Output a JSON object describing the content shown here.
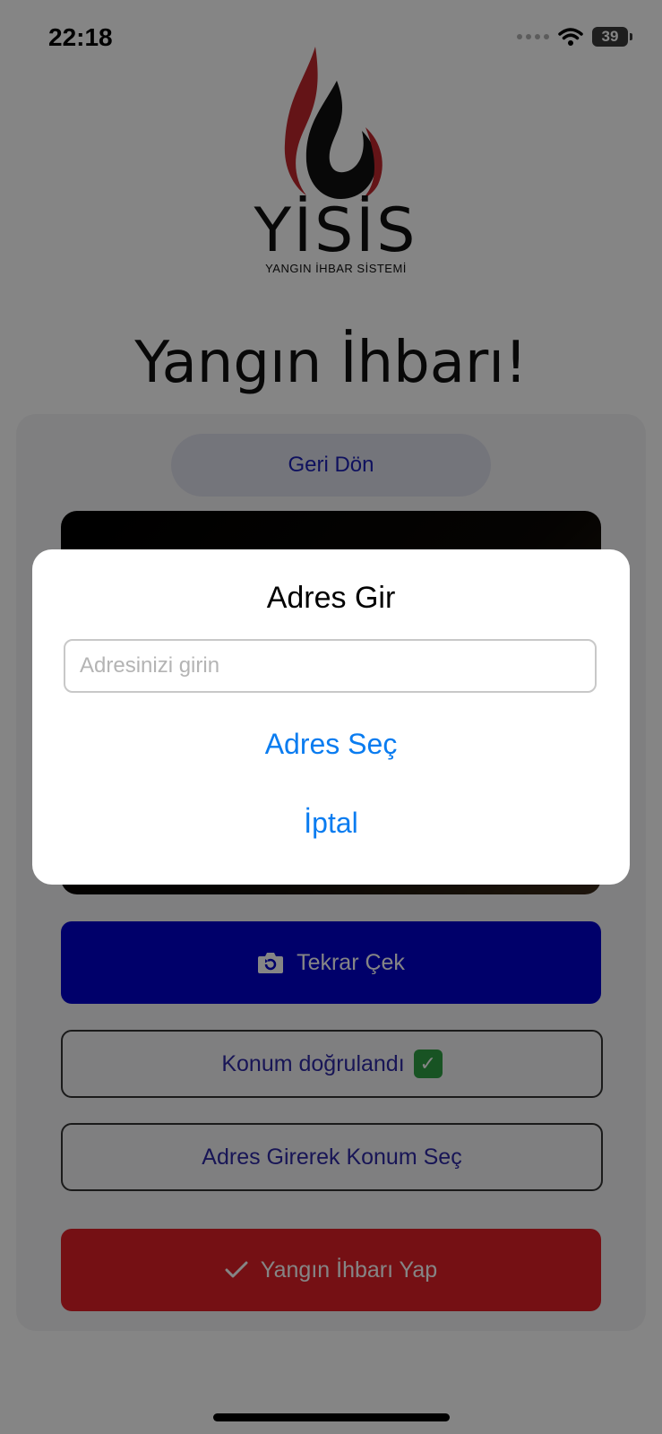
{
  "status_bar": {
    "time": "22:18",
    "battery": "39"
  },
  "logo": {
    "word": "YİSİS",
    "subtitle": "YANGIN İHBAR SİSTEMİ"
  },
  "page_title": "Yangın İhbarı!",
  "card": {
    "back_label": "Geri Dön",
    "retake_label": "Tekrar Çek",
    "location_verified_label": "Konum doğrulandı",
    "address_location_label": "Adres Girerek Konum Seç",
    "submit_label": "Yangın İhbarı Yap"
  },
  "modal": {
    "title": "Adres Gir",
    "input_value": "",
    "input_placeholder": "Adresinizi girin",
    "select_label": "Adres Seç",
    "cancel_label": "İptal"
  },
  "colors": {
    "primary_blue": "#0000cc",
    "danger_red": "#e01f27",
    "link_blue": "#0a7cf0",
    "logo_red": "#c0282d"
  },
  "icons": [
    "wifi-icon",
    "camera-rotate-icon",
    "check-box-icon",
    "checkmark-icon",
    "flame-logo"
  ]
}
